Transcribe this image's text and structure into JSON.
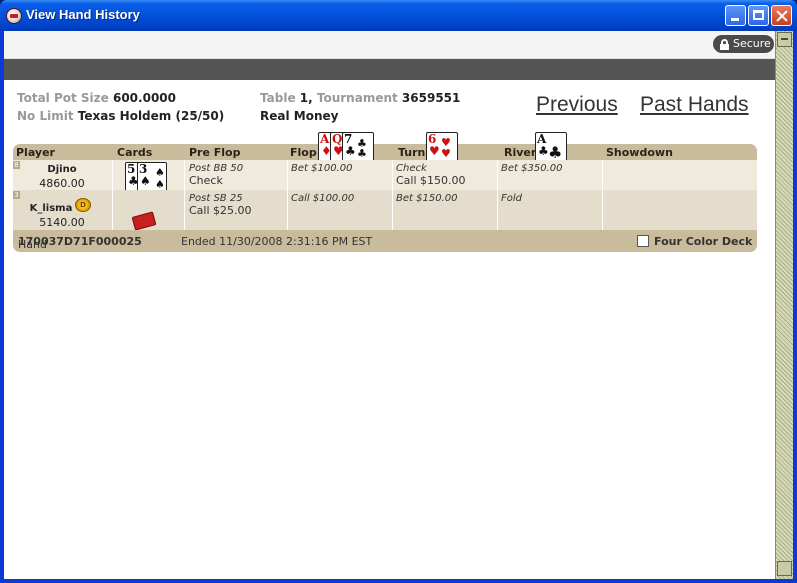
{
  "window": {
    "title": "View Hand History"
  },
  "topbar": {
    "secure_label": "Secure"
  },
  "info": {
    "pot_label": "Total Pot Size",
    "pot_value": "600.0000",
    "limit_label": "No Limit",
    "game_value": "Texas Holdem",
    "blinds_value": "(25/50)",
    "table_label": "Table",
    "table_value": "1,",
    "tournament_label": "Tournament",
    "tournament_value": "3659551",
    "money_value": "Real Money"
  },
  "nav": {
    "previous_label": "Previous",
    "past_hands_label": "Past Hands"
  },
  "table": {
    "headers": {
      "player": "Player",
      "cards": "Cards",
      "preflop": "Pre Flop",
      "flop": "Flop",
      "turn": "Turn",
      "river": "River",
      "showdown": "Showdown"
    },
    "board": {
      "flop": [
        {
          "rank": "A",
          "suit": "♦",
          "color": "#cc1111"
        },
        {
          "rank": "Q",
          "suit": "♥",
          "color": "#cc1111"
        },
        {
          "rank": "7",
          "suit": "♣",
          "color": "#111111"
        }
      ],
      "turn": [
        {
          "rank": "6",
          "suit": "♥",
          "color": "#cc1111"
        }
      ],
      "river": [
        {
          "rank": "A",
          "suit": "♣",
          "color": "#111111"
        }
      ]
    },
    "rows": [
      {
        "seat": "8",
        "player": "Djino",
        "stack": "4860.00",
        "cards": [
          {
            "rank": "5",
            "suit": "♣",
            "color": "#111111"
          },
          {
            "rank": "3",
            "suit": "♠",
            "color": "#111111"
          }
        ],
        "preflop": {
          "italic": "Post BB 50",
          "plain": "Check"
        },
        "flop": {
          "italic": "Bet $100.00",
          "plain": ""
        },
        "turn": {
          "italic": "Check",
          "plain": "Call $150.00"
        },
        "river": {
          "italic": "Bet $350.00",
          "plain": ""
        },
        "showdown": ""
      },
      {
        "seat": "3",
        "player": "K_lisma",
        "stack": "5140.00",
        "chip_label": "D",
        "preflop": {
          "italic": "Post SB 25",
          "plain": "Call $25.00"
        },
        "flop": {
          "italic": "Call $100.00",
          "plain": ""
        },
        "turn": {
          "italic": "Bet $150.00",
          "plain": ""
        },
        "river": {
          "italic": "Fold",
          "plain": ""
        },
        "showdown": ""
      }
    ]
  },
  "footer": {
    "hand_label": "Hand",
    "hand_id": "170037D71F000025",
    "ended_text": "Ended 11/30/2008 2:31:16 PM EST",
    "four_color_label": "Four Color Deck",
    "four_color_checked": false
  },
  "colors": {
    "titlebar": "#0453dc",
    "table_bg": "#c9bc9c",
    "row_light": "#efeadc",
    "row_dark": "#e4ddcb",
    "dark_bar": "#555555"
  }
}
